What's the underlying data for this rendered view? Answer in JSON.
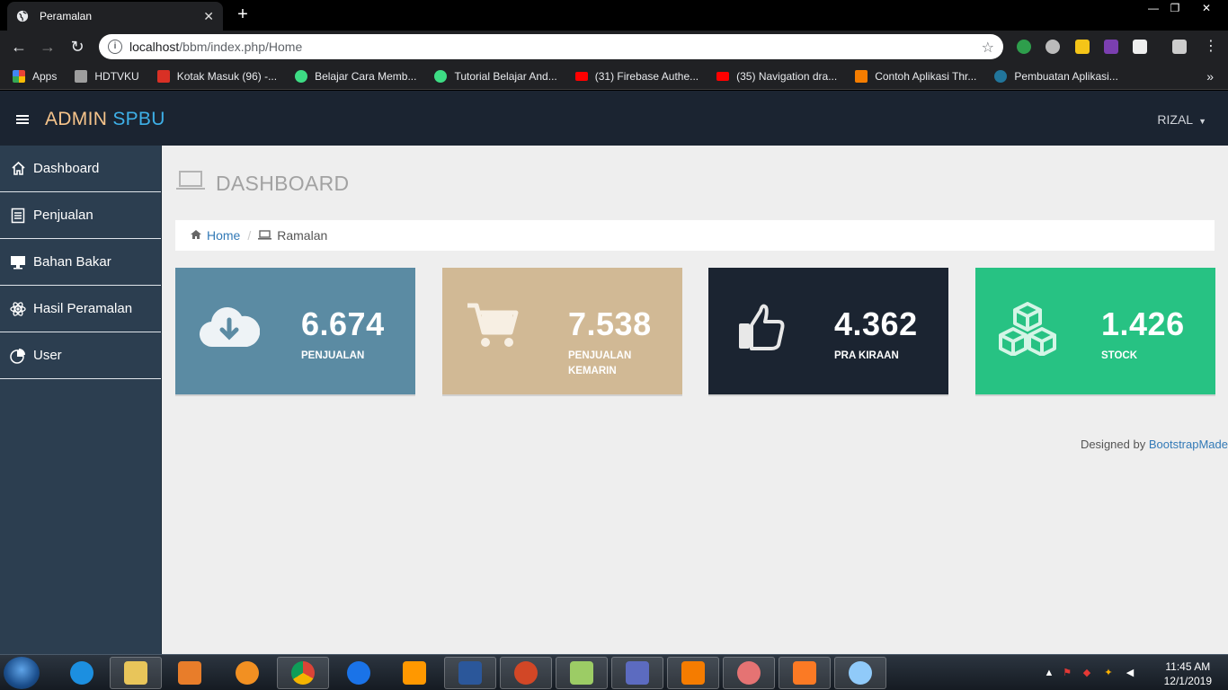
{
  "browser": {
    "tab_title": "Peramalan",
    "url_host": "localhost",
    "url_path": "/bbm/index.php/Home",
    "bookmarks": [
      {
        "label": "Apps",
        "color": "#f4b400"
      },
      {
        "label": "HDTVKU",
        "color": "#9e9e9e"
      },
      {
        "label": "Kotak Masuk (96) -...",
        "color": "#d93025"
      },
      {
        "label": "Belajar Cara Memb...",
        "color": "#3ddc84"
      },
      {
        "label": "Tutorial Belajar And...",
        "color": "#3ddc84"
      },
      {
        "label": "(31) Firebase Authe...",
        "color": "#ff0000"
      },
      {
        "label": "(35) Navigation dra...",
        "color": "#ff0000"
      },
      {
        "label": "Contoh Aplikasi Thr...",
        "color": "#f57d00"
      },
      {
        "label": "Pembuatan Aplikasi...",
        "color": "#21759b"
      }
    ]
  },
  "app": {
    "brand_part1": "ADMIN",
    "brand_part2": "SPBU",
    "user_name": "RIZAL",
    "colors": {
      "header": "#1b2431",
      "sidebar": "#2c3e50",
      "brand_orange": "#f6c48b",
      "brand_blue": "#3eb0e8"
    }
  },
  "sidebar": {
    "items": [
      {
        "label": "Dashboard",
        "icon": "home-icon"
      },
      {
        "label": "Penjualan",
        "icon": "list-icon"
      },
      {
        "label": "Bahan Bakar",
        "icon": "desktop-icon"
      },
      {
        "label": "Hasil Peramalan",
        "icon": "atom-icon"
      },
      {
        "label": "User",
        "icon": "pie-chart-icon"
      }
    ]
  },
  "main": {
    "page_title": "DASHBOARD",
    "breadcrumb": {
      "home": "Home",
      "current": "Ramalan"
    },
    "cards": [
      {
        "value": "6.674",
        "label": "PENJUALAN",
        "color": "#5b8ba3",
        "icon": "cloud-download-icon"
      },
      {
        "value": "7.538",
        "label": "PENJUALAN KEMARIN",
        "color": "#d1b995",
        "icon": "shopping-cart-icon"
      },
      {
        "value": "4.362",
        "label": "PRA KIRAAN",
        "color": "#1b2431",
        "icon": "thumbs-up-icon"
      },
      {
        "value": "1.426",
        "label": "STOCK",
        "color": "#27c283",
        "icon": "cubes-icon"
      }
    ],
    "footer_text": "Designed by ",
    "footer_link": "BootstrapMade"
  },
  "taskbar": {
    "time": "11:45 AM",
    "date": "12/1/2019"
  }
}
